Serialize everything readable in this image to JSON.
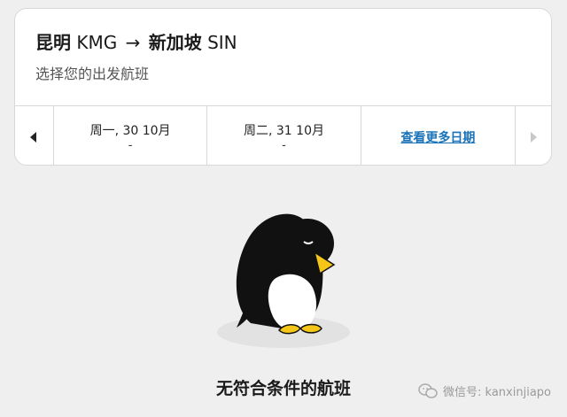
{
  "header": {
    "origin_city": "昆明",
    "origin_code": "KMG",
    "arrow": "→",
    "dest_city": "新加坡",
    "dest_code": "SIN",
    "subtitle": "选择您的出发航班"
  },
  "dates": [
    {
      "label": "周一, 30 10月",
      "price": "-"
    },
    {
      "label": "周二, 31 10月",
      "price": "-"
    }
  ],
  "more_dates_link": "查看更多日期",
  "empty_state": {
    "message": "无符合条件的航班",
    "illustration": "sad-penguin"
  },
  "watermark": {
    "text": "微信号: kanxinjiapo",
    "icon": "wechat-icon"
  },
  "icons": {
    "prev": "caret-left-icon",
    "next": "caret-right-icon"
  },
  "colors": {
    "link": "#1a73b8",
    "beak": "#f5c518",
    "background": "#efefef"
  }
}
